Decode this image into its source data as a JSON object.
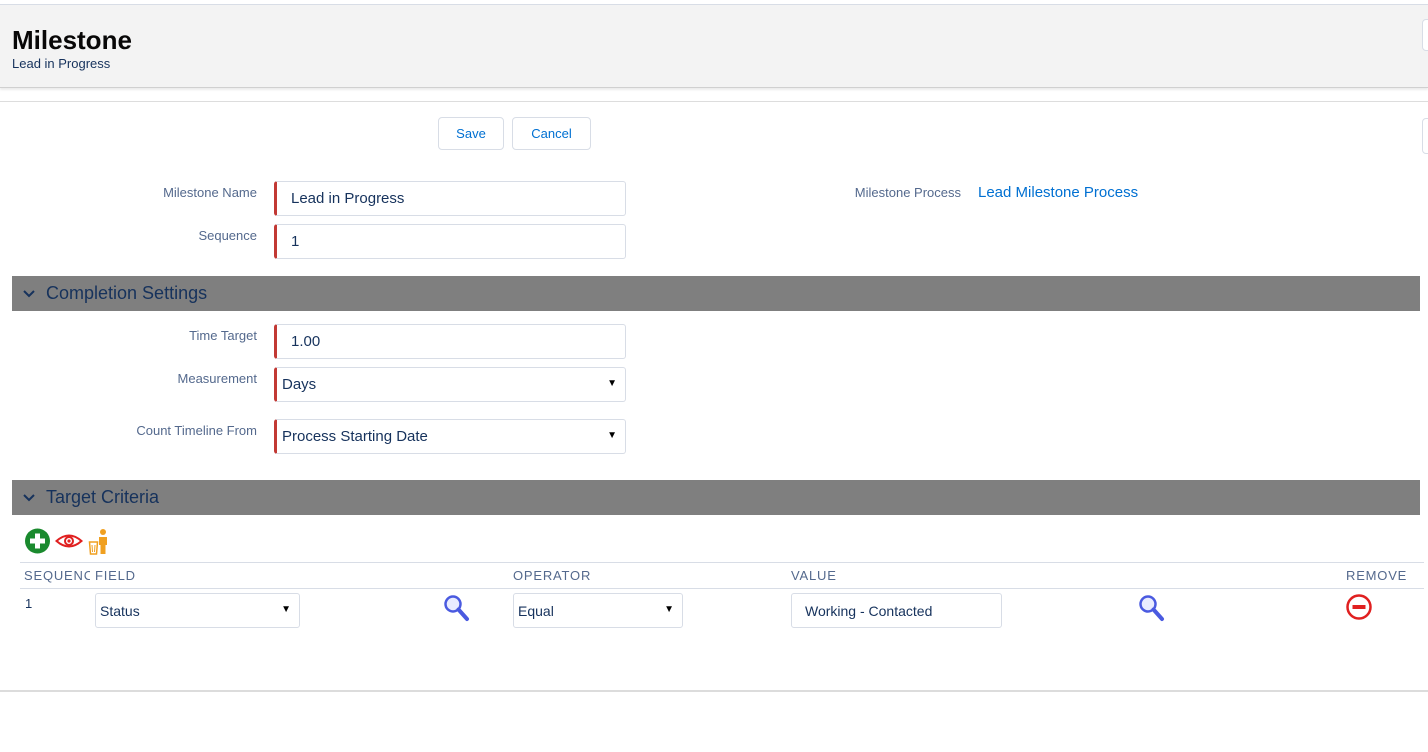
{
  "header": {
    "title": "Milestone",
    "subtitle": "Lead in Progress"
  },
  "actions": {
    "save_label": "Save",
    "cancel_label": "Cancel"
  },
  "form": {
    "milestone_name_label": "Milestone Name",
    "milestone_name_value": "Lead in Progress",
    "sequence_label": "Sequence",
    "sequence_value": "1",
    "milestone_process_label": "Milestone Process",
    "milestone_process_value": "Lead Milestone Process"
  },
  "completion": {
    "section_title": "Completion Settings",
    "time_target_label": "Time Target",
    "time_target_value": "1.00",
    "measurement_label": "Measurement",
    "measurement_value": "Days",
    "count_from_label": "Count Timeline From",
    "count_from_value": "Process Starting Date"
  },
  "criteria": {
    "section_title": "Target Criteria",
    "toolbar_icons": [
      "add-icon",
      "eye-icon",
      "trash-person-icon"
    ],
    "columns": {
      "sequence": "SEQUENCE",
      "field": "FIELD",
      "operator": "OPERATOR",
      "value": "VALUE",
      "remove": "REMOVE"
    },
    "rows": [
      {
        "sequence": "1",
        "field": "Status",
        "operator": "Equal",
        "value": "Working - Contacted"
      }
    ]
  },
  "colors": {
    "accent": "#0070d2",
    "required": "#c23934",
    "section_bar": "#7f7f7f",
    "add_green": "#1a8a2e",
    "remove_red": "#e02020"
  }
}
